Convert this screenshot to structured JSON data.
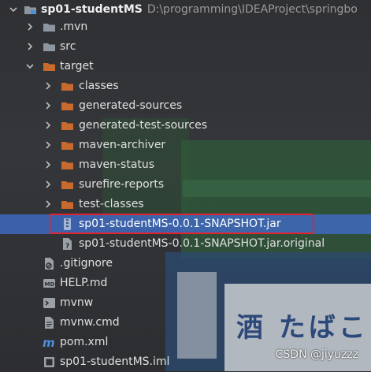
{
  "project_tree": {
    "root": {
      "name": "sp01-studentMS",
      "path": "D:\\programming\\IDEAProject\\springbo"
    },
    "items": [
      {
        "label": ".mvn",
        "type": "folder",
        "icon": "folder-icon"
      },
      {
        "label": "src",
        "type": "folder",
        "icon": "folder-icon"
      },
      {
        "label": "target",
        "type": "folder",
        "icon": "folder-orange-icon",
        "expanded": true
      },
      {
        "label": "classes",
        "type": "folder",
        "icon": "folder-orange-icon"
      },
      {
        "label": "generated-sources",
        "type": "folder",
        "icon": "folder-orange-icon"
      },
      {
        "label": "generated-test-sources",
        "type": "folder",
        "icon": "folder-orange-icon"
      },
      {
        "label": "maven-archiver",
        "type": "folder",
        "icon": "folder-orange-icon"
      },
      {
        "label": "maven-status",
        "type": "folder",
        "icon": "folder-orange-icon"
      },
      {
        "label": "surefire-reports",
        "type": "folder",
        "icon": "folder-orange-icon"
      },
      {
        "label": "test-classes",
        "type": "folder",
        "icon": "folder-orange-icon"
      },
      {
        "label": "sp01-studentMS-0.0.1-SNAPSHOT.jar",
        "type": "file",
        "icon": "jar-file-icon",
        "selected": true
      },
      {
        "label": "sp01-studentMS-0.0.1-SNAPSHOT.jar.original",
        "type": "file",
        "icon": "unknown-file-icon"
      },
      {
        "label": ".gitignore",
        "type": "file",
        "icon": "gitignore-file-icon"
      },
      {
        "label": "HELP.md",
        "type": "file",
        "icon": "markdown-file-icon"
      },
      {
        "label": "mvnw",
        "type": "file",
        "icon": "terminal-file-icon"
      },
      {
        "label": "mvnw.cmd",
        "type": "file",
        "icon": "text-file-icon"
      },
      {
        "label": "pom.xml",
        "type": "file",
        "icon": "maven-pom-icon"
      },
      {
        "label": "sp01-studentMS.iml",
        "type": "file",
        "icon": "iml-file-icon"
      }
    ]
  },
  "background_sign_text": "酒 たばこ",
  "watermark": "CSDN @jiyuzzz",
  "colors": {
    "selection": "#4068be",
    "highlight_border": "#e0242f",
    "folder_orange": "#c86a2e",
    "folder_gray": "#8d96a0"
  }
}
